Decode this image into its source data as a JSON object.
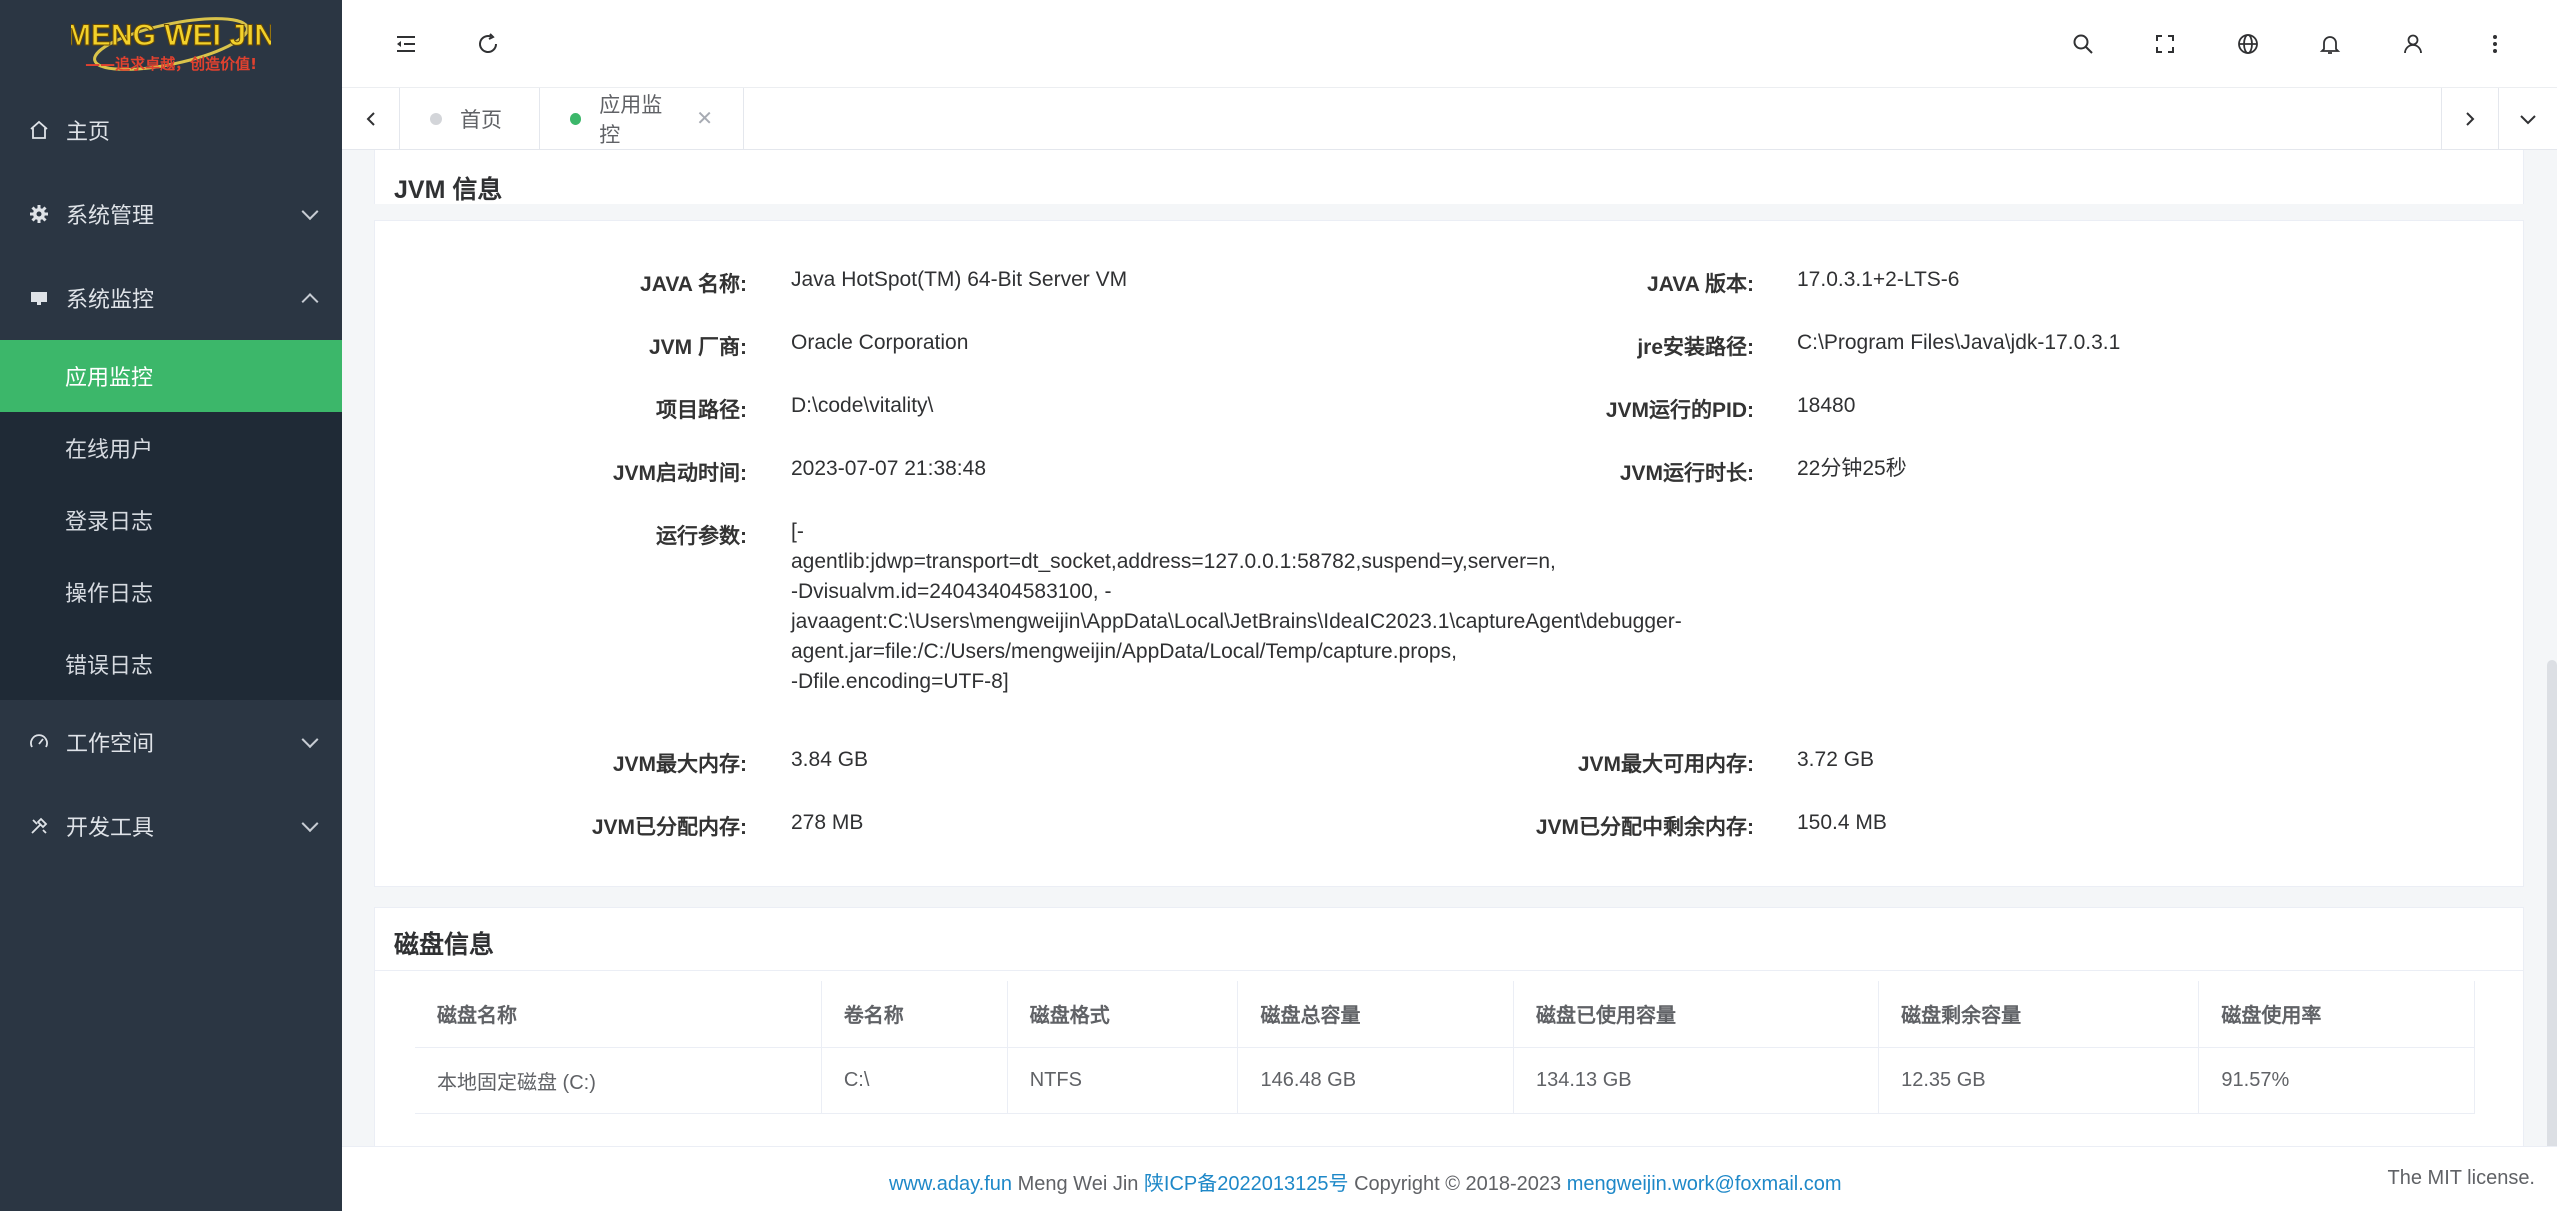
{
  "brand": {
    "logo_text": "MENG WEI JIN",
    "slogan": "——追求卓越，创造价值!"
  },
  "sidebar": {
    "items": [
      {
        "label": "主页"
      },
      {
        "label": "系统管理"
      },
      {
        "label": "系统监控"
      },
      {
        "label": "工作空间"
      },
      {
        "label": "开发工具"
      }
    ],
    "monitor_sub": [
      {
        "label": "应用监控"
      },
      {
        "label": "在线用户"
      },
      {
        "label": "登录日志"
      },
      {
        "label": "操作日志"
      },
      {
        "label": "错误日志"
      }
    ]
  },
  "tabs": [
    {
      "label": "首页"
    },
    {
      "label": "应用监控"
    }
  ],
  "jvm": {
    "title": "JVM 信息",
    "java_name_label": "JAVA 名称:",
    "java_name": "Java HotSpot(TM) 64-Bit Server VM",
    "java_version_label": "JAVA 版本:",
    "java_version": "17.0.3.1+2-LTS-6",
    "vendor_label": "JVM 厂商:",
    "vendor": "Oracle Corporation",
    "jre_path_label": "jre安装路径:",
    "jre_path": "C:\\Program Files\\Java\\jdk-17.0.3.1",
    "project_path_label": "项目路径:",
    "project_path": "D:\\code\\vitality\\",
    "pid_label": "JVM运行的PID:",
    "pid": "18480",
    "start_time_label": "JVM启动时间:",
    "start_time": "2023-07-07 21:38:48",
    "uptime_label": "JVM运行时长:",
    "uptime": "22分钟25秒",
    "args_label": "运行参数:",
    "args_lines": [
      "[-",
      "agentlib:jdwp=transport=dt_socket,address=127.0.0.1:58782,suspend=y,server=n,",
      "-Dvisualvm.id=24043404583100, -",
      "javaagent:C:\\Users\\mengweijin\\AppData\\Local\\JetBrains\\IdeaIC2023.1\\captureAgent\\debugger-",
      "agent.jar=file:/C:/Users/mengweijin/AppData/Local/Temp/capture.props,",
      "-Dfile.encoding=UTF-8]"
    ],
    "max_mem_label": "JVM最大内存:",
    "max_mem": "3.84 GB",
    "max_avail_label": "JVM最大可用内存:",
    "max_avail": "3.72 GB",
    "alloc_label": "JVM已分配内存:",
    "alloc": "278 MB",
    "alloc_free_label": "JVM已分配中剩余内存:",
    "alloc_free": "150.4 MB"
  },
  "disk": {
    "title": "磁盘信息",
    "headers": [
      "磁盘名称",
      "卷名称",
      "磁盘格式",
      "磁盘总容量",
      "磁盘已使用容量",
      "磁盘剩余容量",
      "磁盘使用率"
    ],
    "rows": [
      [
        "本地固定磁盘 (C:)",
        "C:\\",
        "NTFS",
        "146.48 GB",
        "134.13 GB",
        "12.35 GB",
        "91.57%"
      ]
    ]
  },
  "footer": {
    "site": "www.aday.fun",
    "name": " Meng Wei Jin ",
    "icp": "陕ICP备2022013125号",
    "copyright": " Copyright © 2018-2023 ",
    "email": "mengweijin.work@foxmail.com",
    "license": "The MIT license."
  },
  "colors": {
    "sidebar": "#2b3643",
    "submenu": "#1f2a36",
    "accent": "#3cb76a",
    "link": "#1e88c8"
  }
}
